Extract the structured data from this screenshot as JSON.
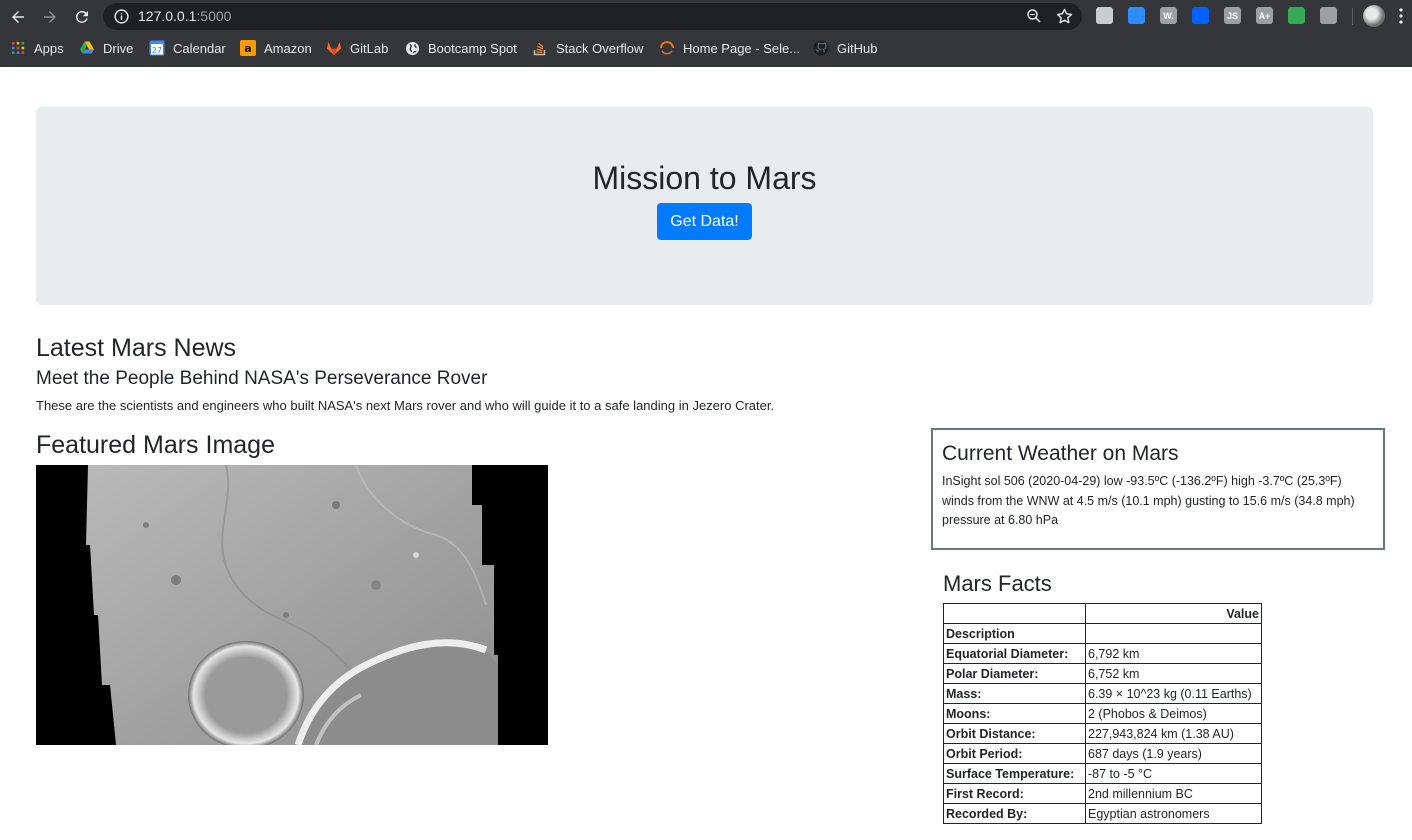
{
  "browser": {
    "url_host": "127.0.0.1",
    "url_port": ":5000",
    "bookmarks": [
      {
        "label": "Apps",
        "icon": "apps-grid-icon"
      },
      {
        "label": "Drive",
        "icon": "google-drive-icon"
      },
      {
        "label": "Calendar",
        "icon": "calendar-icon",
        "badge": "27"
      },
      {
        "label": "Amazon",
        "icon": "amazon-icon"
      },
      {
        "label": "GitLab",
        "icon": "gitlab-icon"
      },
      {
        "label": "Bootcamp Spot",
        "icon": "globe-icon"
      },
      {
        "label": "Stack Overflow",
        "icon": "stack-overflow-icon"
      },
      {
        "label": "Home Page - Sele...",
        "icon": "loading-spinner-icon"
      },
      {
        "label": "GitHub",
        "icon": "github-icon"
      }
    ],
    "extensions": [
      {
        "icon": "extension-h-icon",
        "color": "#c9cdd2"
      },
      {
        "icon": "extension-board-icon",
        "color": "#2d8cff"
      },
      {
        "icon": "extension-w-icon",
        "color": "#9aa0a6",
        "text": "W."
      },
      {
        "icon": "extension-dropbox-icon",
        "color": "#0061ff"
      },
      {
        "icon": "extension-js-icon",
        "color": "#9aa0a6",
        "text": "JS"
      },
      {
        "icon": "extension-aplus-icon",
        "color": "#9aa0a6",
        "text": "A+"
      },
      {
        "icon": "extension-chrome-icon",
        "color": "#34a853"
      },
      {
        "icon": "extension-window-icon",
        "color": "#9aa0a6"
      }
    ]
  },
  "jumbotron": {
    "title": "Mission to Mars",
    "button_label": "Get Data!"
  },
  "news": {
    "heading": "Latest Mars News",
    "title": "Meet the People Behind NASA's Perseverance Rover",
    "paragraph": "These are the scientists and engineers who built NASA's next Mars rover and who will guide it to a safe landing in Jezero Crater."
  },
  "featured_image": {
    "heading": "Featured Mars Image"
  },
  "weather": {
    "heading": "Current Weather on Mars",
    "text": "InSight sol 506 (2020-04-29) low -93.5ºC (-136.2ºF) high -3.7ºC (25.3ºF) winds from the WNW at 4.5 m/s (10.1 mph) gusting to 15.6 m/s (34.8 mph) pressure at 6.80 hPa"
  },
  "facts": {
    "heading": "Mars Facts",
    "header_blank": "",
    "header_value": "Value",
    "description_label": "Description",
    "rows": [
      {
        "label": "Equatorial Diameter:",
        "value": "6,792 km"
      },
      {
        "label": "Polar Diameter:",
        "value": "6,752 km"
      },
      {
        "label": "Mass:",
        "value": "6.39 × 10^23 kg (0.11 Earths)"
      },
      {
        "label": "Moons:",
        "value": "2 (Phobos & Deimos)"
      },
      {
        "label": "Orbit Distance:",
        "value": "227,943,824 km (1.38 AU)"
      },
      {
        "label": "Orbit Period:",
        "value": "687 days (1.9 years)"
      },
      {
        "label": "Surface Temperature:",
        "value": "-87 to -5 °C"
      },
      {
        "label": "First Record:",
        "value": "2nd millennium BC"
      },
      {
        "label": "Recorded By:",
        "value": "Egyptian astronomers"
      }
    ]
  }
}
